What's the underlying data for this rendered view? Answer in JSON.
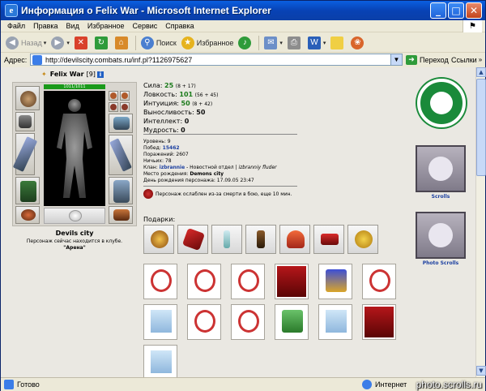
{
  "window": {
    "title": "Информация о Felix War - Microsoft Internet Explorer"
  },
  "menu": [
    "Файл",
    "Правка",
    "Вид",
    "Избранное",
    "Сервис",
    "Справка"
  ],
  "toolbar": {
    "back_label": "Назад",
    "search_label": "Поиск",
    "favorites_label": "Избранное"
  },
  "address": {
    "label": "Адрес:",
    "url": "http://devilscity.combats.ru/inf.pl?1126975627",
    "go_label": "Переход",
    "links_label": "Ссылки"
  },
  "status": {
    "ready": "Готово",
    "zone": "Интернет",
    "watermark": "photo.scrolls.ru"
  },
  "character": {
    "name": "Felix War",
    "level_badge": "[9]",
    "hp": "1011/1011",
    "city": "Devils city",
    "location_text": "Персонаж сейчас находится в клубе.",
    "room": "\"Арена\""
  },
  "stats": [
    {
      "label": "Сила:",
      "value": "25",
      "extra": "(8 + 17)"
    },
    {
      "label": "Ловкость:",
      "value": "101",
      "extra": "(56 + 45)"
    },
    {
      "label": "Интуиция:",
      "value": "50",
      "extra": "(8 + 42)"
    },
    {
      "label": "Выносливость:",
      "value": "50",
      "extra": ""
    },
    {
      "label": "Интеллект:",
      "value": "0",
      "extra": ""
    },
    {
      "label": "Мудрость:",
      "value": "0",
      "extra": ""
    }
  ],
  "details": {
    "level": "Уровень: 9",
    "wins_label": "Побед:",
    "wins": "15462",
    "losses": "Поражений: 2607",
    "draws": "Ничьих: 78",
    "clan_label": "Клан:",
    "clan": "izbrannie",
    "clan_rest": "- Новостной отдел |",
    "clan_role": "izbranniy fluder",
    "birthplace_label": "Место рождения:",
    "birthplace": "Demons city",
    "birthday": "День рождения персонажа: 17.09.05 23:47"
  },
  "weakness": "Персонаж ослаблен из-за смерти в бою, еще 10 мин.",
  "gifts_label": "Подарки:",
  "right": {
    "banner1_label": "Scrolls",
    "banner2_label": "Photo Scrolls"
  },
  "colors": {
    "title_bar": "#0842B5",
    "clan_badge": "#1a8a3a",
    "link": "#1b3fa0"
  }
}
